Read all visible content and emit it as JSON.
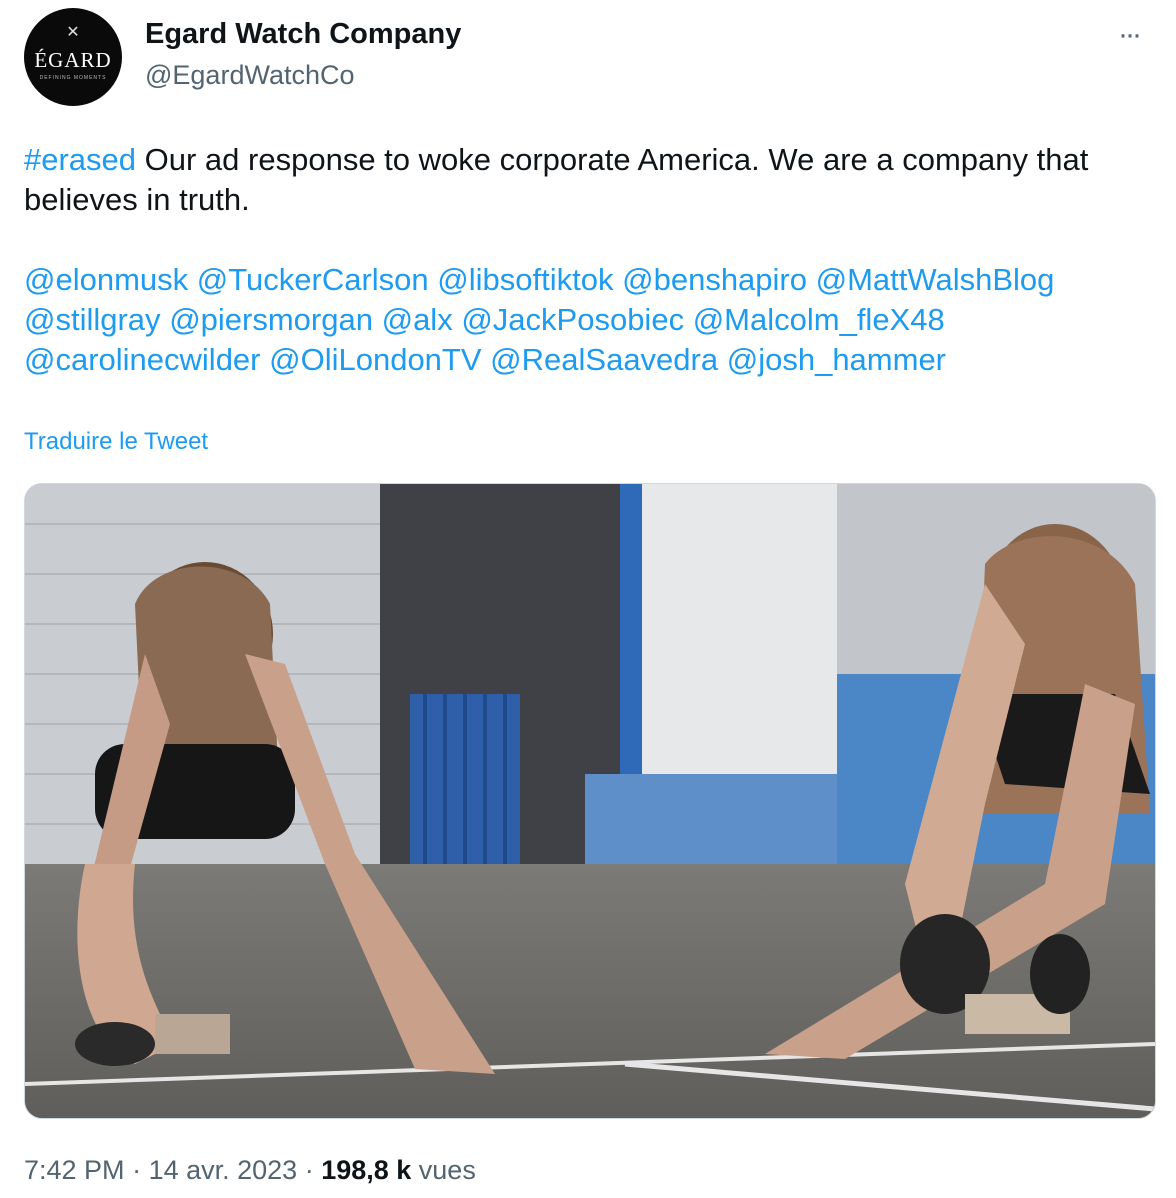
{
  "account": {
    "name": "Egard Watch Company",
    "handle": "@EgardWatchCo",
    "avatar": {
      "brand": "ÉGARD",
      "tagline": "DEFINING MOMENTS"
    }
  },
  "tweet": {
    "hashtag": "#erased",
    "text": " Our ad response to woke corporate America. We are a company that believes in truth.",
    "mentions": [
      "@elonmusk",
      "@TuckerCarlson",
      "@libsoftiktok",
      "@benshapiro",
      "@MattWalshBlog",
      "@stillgray",
      "@piersmorgan",
      "@alx",
      "@JackPosobiec",
      "@Malcolm_fleX48",
      "@carolinecwilder",
      "@OliLondonTV",
      "@RealSaavedra",
      "@josh_hammer"
    ],
    "translate_label": "Traduire le Tweet"
  },
  "meta": {
    "time": "7:42 PM",
    "sep1": " · ",
    "date": "14 avr. 2023",
    "sep2": " · ",
    "views_count": "198,8 k",
    "views_label": " vues"
  },
  "colors": {
    "link": "#1d9bf0",
    "secondary": "#536471",
    "text": "#0f1419"
  }
}
